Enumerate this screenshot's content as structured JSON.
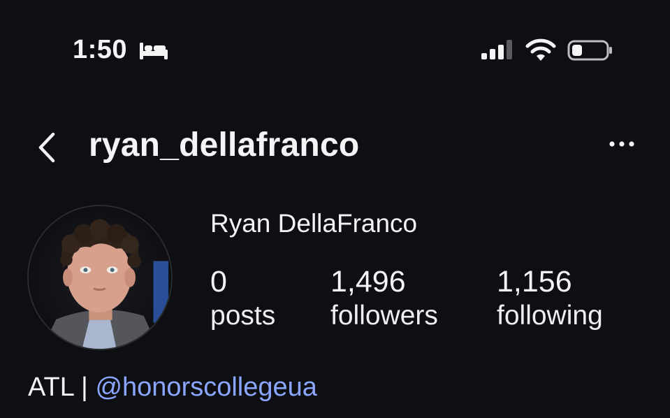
{
  "status_bar": {
    "time": "1:50",
    "focus_icon": "bed-icon",
    "signal_icon": "cellular-signal-icon",
    "wifi_icon": "wifi-icon",
    "battery_icon": "battery-icon"
  },
  "header": {
    "username": "ryan_dellafranco",
    "back_icon": "chevron-left-icon",
    "more_icon": "more-horizontal-icon"
  },
  "profile": {
    "display_name": "Ryan DellaFranco",
    "stats": {
      "posts": {
        "value": "0",
        "label": "posts"
      },
      "followers": {
        "value": "1,496",
        "label": "followers"
      },
      "following": {
        "value": "1,156",
        "label": "following"
      }
    },
    "bio_prefix": "ATL | ",
    "bio_mention": "@honorscollegeua"
  },
  "colors": {
    "background": "#0e0f13",
    "text": "#f4f4f6",
    "link": "#8ba6ff"
  }
}
